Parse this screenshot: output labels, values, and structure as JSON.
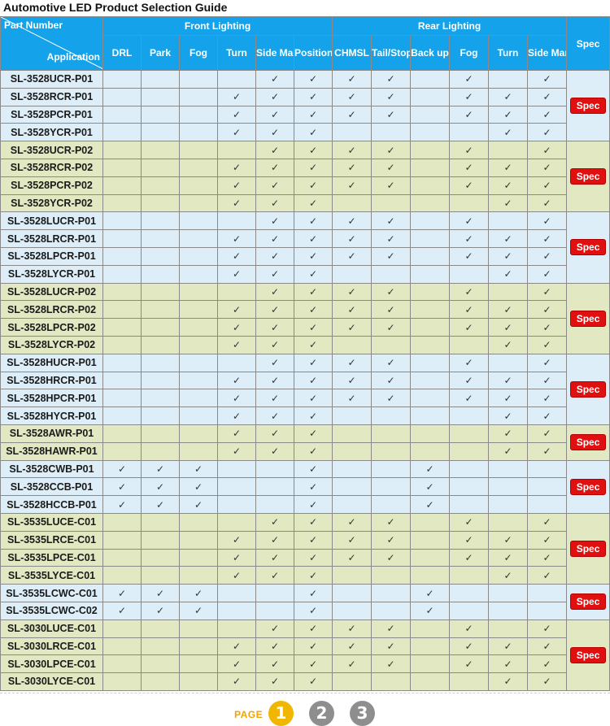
{
  "title": "Automotive LED Product Selection Guide",
  "header": {
    "part_number": "Part Number",
    "application": "Application",
    "front_group": "Front  Lighting",
    "rear_group": "Rear  Lighting",
    "spec": "Spec",
    "front_cols": [
      "DRL",
      "Park",
      "Fog",
      "Turn",
      "Side Marker",
      "Position"
    ],
    "rear_cols": [
      "CHMSL",
      "Tail/Stop",
      "Back up",
      "Fog",
      "Turn",
      "Side Marker"
    ]
  },
  "check_mark": "✓",
  "spec_label": "Spec",
  "groups": [
    {
      "color": "blue",
      "rows": [
        {
          "part": "SL-3528UCR-P01",
          "checks": [
            0,
            0,
            0,
            0,
            1,
            1,
            1,
            1,
            0,
            1,
            0,
            1
          ]
        },
        {
          "part": "SL-3528RCR-P01",
          "checks": [
            0,
            0,
            0,
            1,
            1,
            1,
            1,
            1,
            0,
            1,
            1,
            1
          ]
        },
        {
          "part": "SL-3528PCR-P01",
          "checks": [
            0,
            0,
            0,
            1,
            1,
            1,
            1,
            1,
            0,
            1,
            1,
            1
          ]
        },
        {
          "part": "SL-3528YCR-P01",
          "checks": [
            0,
            0,
            0,
            1,
            1,
            1,
            0,
            0,
            0,
            0,
            1,
            1
          ]
        }
      ]
    },
    {
      "color": "green",
      "rows": [
        {
          "part": "SL-3528UCR-P02",
          "checks": [
            0,
            0,
            0,
            0,
            1,
            1,
            1,
            1,
            0,
            1,
            0,
            1
          ]
        },
        {
          "part": "SL-3528RCR-P02",
          "checks": [
            0,
            0,
            0,
            1,
            1,
            1,
            1,
            1,
            0,
            1,
            1,
            1
          ]
        },
        {
          "part": "SL-3528PCR-P02",
          "checks": [
            0,
            0,
            0,
            1,
            1,
            1,
            1,
            1,
            0,
            1,
            1,
            1
          ]
        },
        {
          "part": "SL-3528YCR-P02",
          "checks": [
            0,
            0,
            0,
            1,
            1,
            1,
            0,
            0,
            0,
            0,
            1,
            1
          ]
        }
      ]
    },
    {
      "color": "blue",
      "rows": [
        {
          "part": "SL-3528LUCR-P01",
          "checks": [
            0,
            0,
            0,
            0,
            1,
            1,
            1,
            1,
            0,
            1,
            0,
            1
          ]
        },
        {
          "part": "SL-3528LRCR-P01",
          "checks": [
            0,
            0,
            0,
            1,
            1,
            1,
            1,
            1,
            0,
            1,
            1,
            1
          ]
        },
        {
          "part": "SL-3528LPCR-P01",
          "checks": [
            0,
            0,
            0,
            1,
            1,
            1,
            1,
            1,
            0,
            1,
            1,
            1
          ]
        },
        {
          "part": "SL-3528LYCR-P01",
          "checks": [
            0,
            0,
            0,
            1,
            1,
            1,
            0,
            0,
            0,
            0,
            1,
            1
          ]
        }
      ]
    },
    {
      "color": "green",
      "rows": [
        {
          "part": "SL-3528LUCR-P02",
          "checks": [
            0,
            0,
            0,
            0,
            1,
            1,
            1,
            1,
            0,
            1,
            0,
            1
          ]
        },
        {
          "part": "SL-3528LRCR-P02",
          "checks": [
            0,
            0,
            0,
            1,
            1,
            1,
            1,
            1,
            0,
            1,
            1,
            1
          ]
        },
        {
          "part": "SL-3528LPCR-P02",
          "checks": [
            0,
            0,
            0,
            1,
            1,
            1,
            1,
            1,
            0,
            1,
            1,
            1
          ]
        },
        {
          "part": "SL-3528LYCR-P02",
          "checks": [
            0,
            0,
            0,
            1,
            1,
            1,
            0,
            0,
            0,
            0,
            1,
            1
          ]
        }
      ]
    },
    {
      "color": "blue",
      "rows": [
        {
          "part": "SL-3528HUCR-P01",
          "checks": [
            0,
            0,
            0,
            0,
            1,
            1,
            1,
            1,
            0,
            1,
            0,
            1
          ]
        },
        {
          "part": "SL-3528HRCR-P01",
          "checks": [
            0,
            0,
            0,
            1,
            1,
            1,
            1,
            1,
            0,
            1,
            1,
            1
          ]
        },
        {
          "part": "SL-3528HPCR-P01",
          "checks": [
            0,
            0,
            0,
            1,
            1,
            1,
            1,
            1,
            0,
            1,
            1,
            1
          ]
        },
        {
          "part": "SL-3528HYCR-P01",
          "checks": [
            0,
            0,
            0,
            1,
            1,
            1,
            0,
            0,
            0,
            0,
            1,
            1
          ]
        }
      ]
    },
    {
      "color": "green",
      "rows": [
        {
          "part": "SL-3528AWR-P01",
          "checks": [
            0,
            0,
            0,
            1,
            1,
            1,
            0,
            0,
            0,
            0,
            1,
            1
          ]
        },
        {
          "part": "SL-3528HAWR-P01",
          "checks": [
            0,
            0,
            0,
            1,
            1,
            1,
            0,
            0,
            0,
            0,
            1,
            1
          ]
        }
      ]
    },
    {
      "color": "blue",
      "rows": [
        {
          "part": "SL-3528CWB-P01",
          "checks": [
            1,
            1,
            1,
            0,
            0,
            1,
            0,
            0,
            1,
            0,
            0,
            0
          ]
        },
        {
          "part": "SL-3528CCB-P01",
          "checks": [
            1,
            1,
            1,
            0,
            0,
            1,
            0,
            0,
            1,
            0,
            0,
            0
          ]
        },
        {
          "part": "SL-3528HCCB-P01",
          "checks": [
            1,
            1,
            1,
            0,
            0,
            1,
            0,
            0,
            1,
            0,
            0,
            0
          ]
        }
      ]
    },
    {
      "color": "green",
      "rows": [
        {
          "part": "SL-3535LUCE-C01",
          "checks": [
            0,
            0,
            0,
            0,
            1,
            1,
            1,
            1,
            0,
            1,
            0,
            1
          ]
        },
        {
          "part": "SL-3535LRCE-C01",
          "checks": [
            0,
            0,
            0,
            1,
            1,
            1,
            1,
            1,
            0,
            1,
            1,
            1
          ]
        },
        {
          "part": "SL-3535LPCE-C01",
          "checks": [
            0,
            0,
            0,
            1,
            1,
            1,
            1,
            1,
            0,
            1,
            1,
            1
          ]
        },
        {
          "part": "SL-3535LYCE-C01",
          "checks": [
            0,
            0,
            0,
            1,
            1,
            1,
            0,
            0,
            0,
            0,
            1,
            1
          ]
        }
      ]
    },
    {
      "color": "blue",
      "rows": [
        {
          "part": "SL-3535LCWC-C01",
          "checks": [
            1,
            1,
            1,
            0,
            0,
            1,
            0,
            0,
            1,
            0,
            0,
            0
          ]
        },
        {
          "part": "SL-3535LCWC-C02",
          "checks": [
            1,
            1,
            1,
            0,
            0,
            1,
            0,
            0,
            1,
            0,
            0,
            0
          ]
        }
      ]
    },
    {
      "color": "green",
      "rows": [
        {
          "part": "SL-3030LUCE-C01",
          "checks": [
            0,
            0,
            0,
            0,
            1,
            1,
            1,
            1,
            0,
            1,
            0,
            1
          ]
        },
        {
          "part": "SL-3030LRCE-C01",
          "checks": [
            0,
            0,
            0,
            1,
            1,
            1,
            1,
            1,
            0,
            1,
            1,
            1
          ]
        },
        {
          "part": "SL-3030LPCE-C01",
          "checks": [
            0,
            0,
            0,
            1,
            1,
            1,
            1,
            1,
            0,
            1,
            1,
            1
          ]
        },
        {
          "part": "SL-3030LYCE-C01",
          "checks": [
            0,
            0,
            0,
            1,
            1,
            1,
            0,
            0,
            0,
            0,
            1,
            1
          ]
        }
      ]
    }
  ],
  "pager": {
    "label": "PAGE",
    "pages": [
      "1",
      "2",
      "3"
    ],
    "current": "1"
  },
  "colors": {
    "header_blue": "#14a3ea",
    "row_blue": "#ddeef8",
    "row_green": "#e2e8c2",
    "spec_red": "#e01010",
    "page_active": "#f1b600",
    "page_inactive": "#8e8e8e"
  }
}
